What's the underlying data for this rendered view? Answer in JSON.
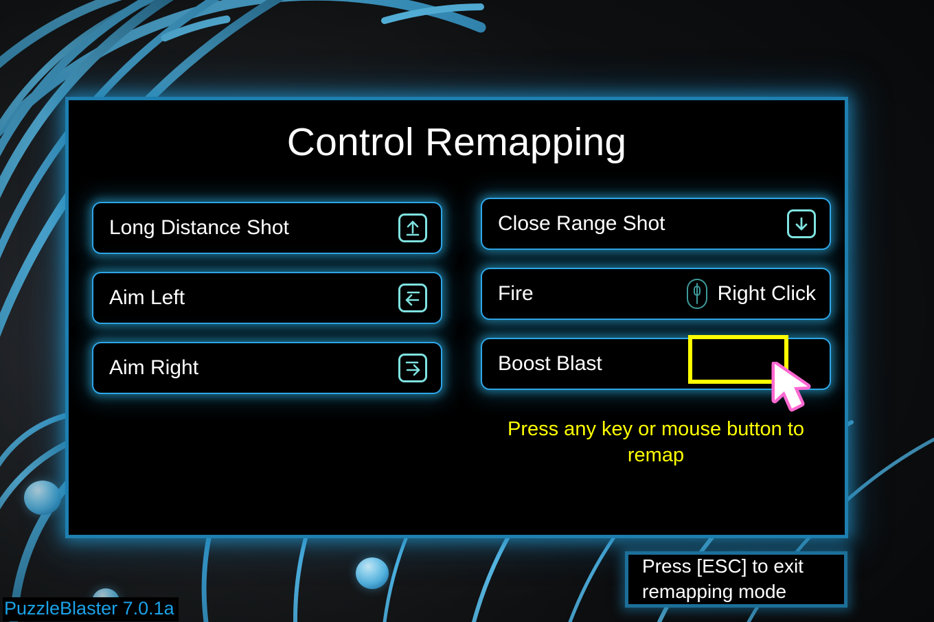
{
  "app": {
    "version_label": "PuzzleBlaster 7.0.1a"
  },
  "panel": {
    "title": "Control Remapping"
  },
  "colors": {
    "panel_border": "#1e7fb0",
    "row_border": "#2fa6e8",
    "key_icon": "#7fe3e0",
    "highlight": "#ffff00",
    "cursor_outline": "#ff69d2",
    "version_text": "#1ba2e8",
    "background": "#1d2023"
  },
  "bindings": {
    "left_column": [
      {
        "action": "Long Distance Shot",
        "binding_kind": "key",
        "icon": "arrow-up-key-icon",
        "binding_text": ""
      },
      {
        "action": "Aim Left",
        "binding_kind": "key",
        "icon": "arrow-left-tab-key-icon",
        "binding_text": ""
      },
      {
        "action": "Aim Right",
        "binding_kind": "key",
        "icon": "arrow-right-tab-key-icon",
        "binding_text": ""
      }
    ],
    "right_column": [
      {
        "action": "Close Range Shot",
        "binding_kind": "key",
        "icon": "arrow-down-key-icon",
        "binding_text": ""
      },
      {
        "action": "Fire",
        "binding_kind": "mouse",
        "icon": "mouse-icon",
        "binding_text": "Right Click"
      },
      {
        "action": "Boost Blast",
        "binding_kind": "awaiting",
        "icon": "",
        "binding_text": ""
      }
    ]
  },
  "prompts": {
    "remap_hint": "Press any key or mouse button to remap",
    "esc_hint_line1": "Press [ESC] to exit",
    "esc_hint_line2": "remapping mode"
  }
}
